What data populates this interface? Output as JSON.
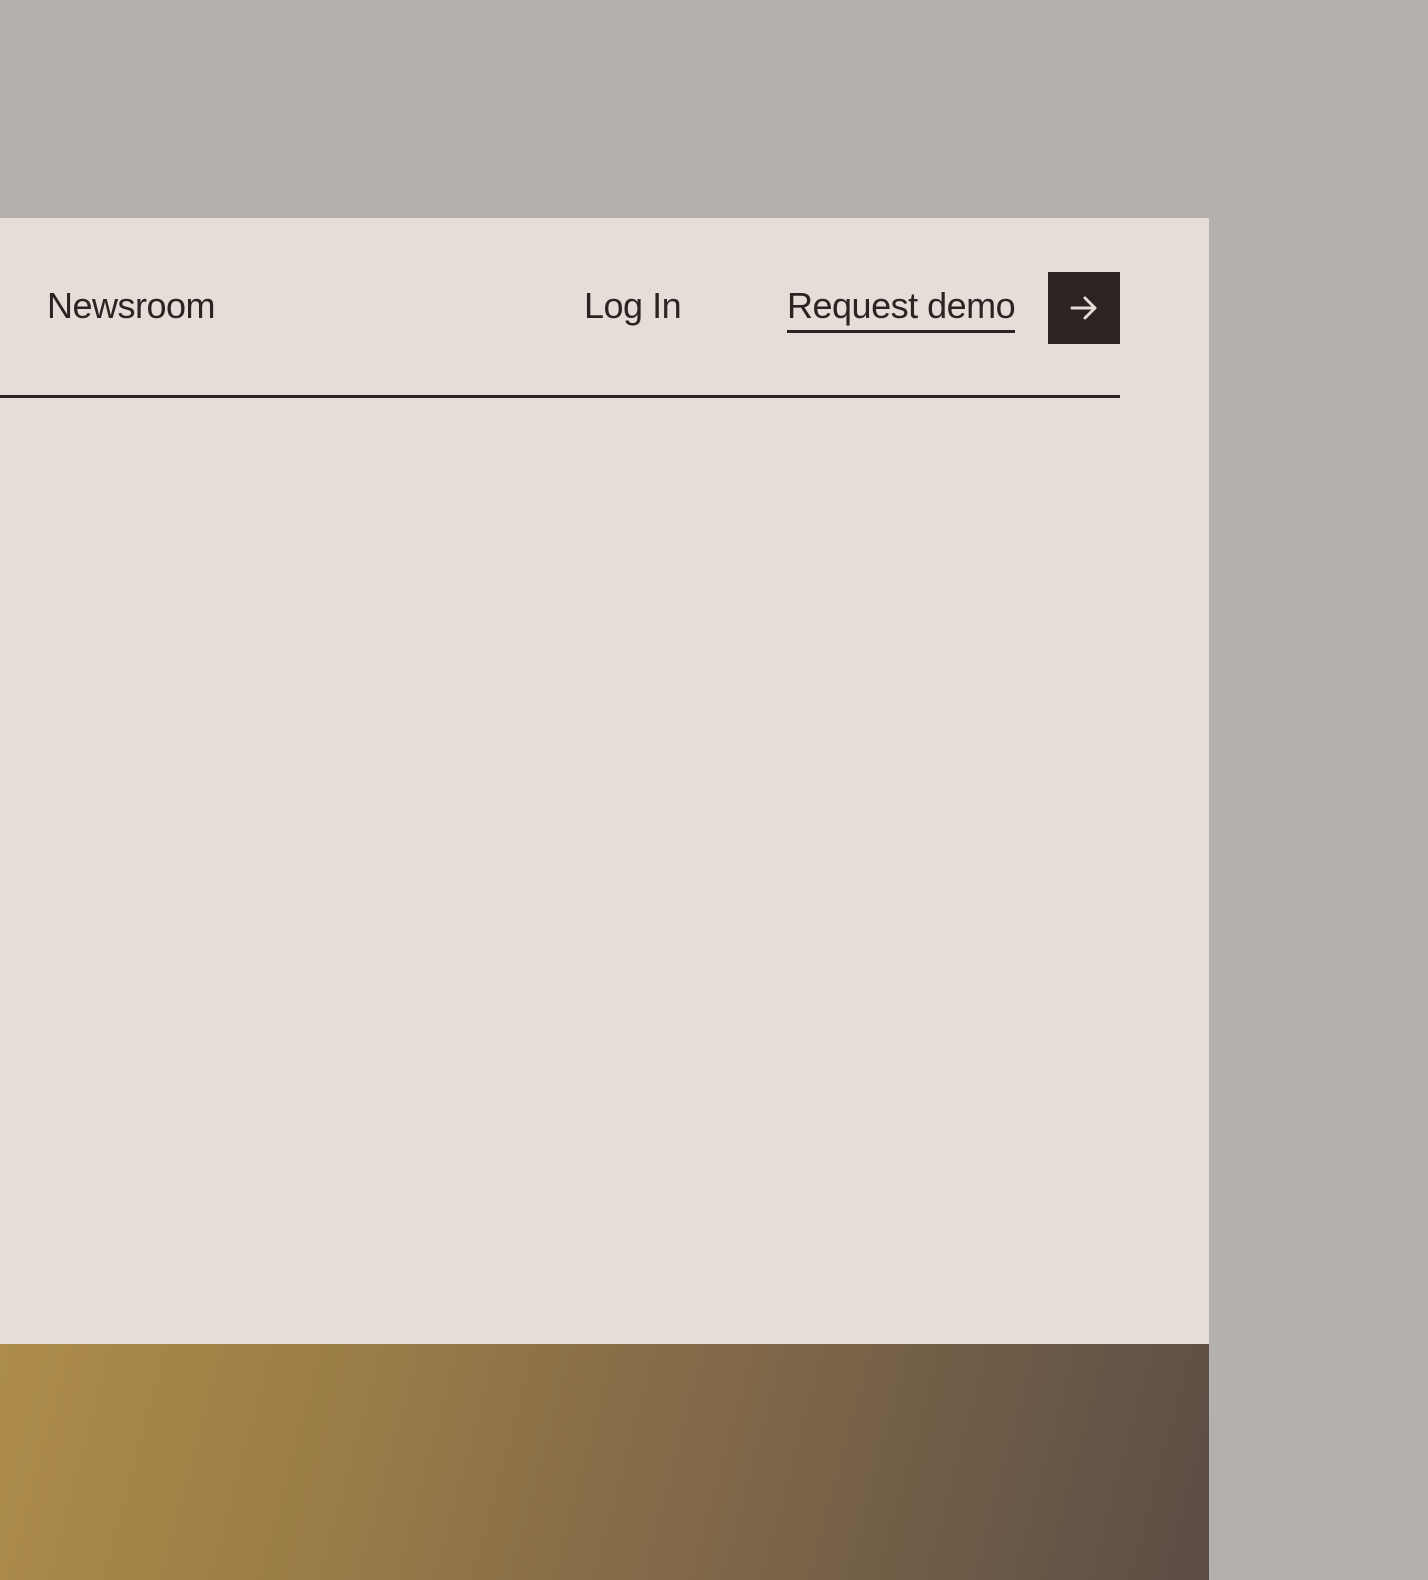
{
  "header": {
    "nav": {
      "newsroom_label": "Newsroom",
      "login_label": "Log In",
      "request_demo_label": "Request demo"
    },
    "demo_button_icon": "arrow-right-icon"
  },
  "colors": {
    "backdrop": "#b4b0ad",
    "panel": "#e5ddd7",
    "ink": "#2c2422",
    "gradient_start": "#ad8c4a",
    "gradient_end": "#5b4d46"
  }
}
